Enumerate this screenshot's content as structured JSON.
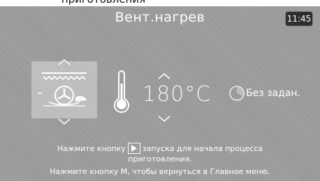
{
  "header": {
    "top_cut_text": "приготовления",
    "title": "Вент.нагрев",
    "clock": "11:45"
  },
  "mode": {
    "icon": "fan-heating-icon"
  },
  "temperature": {
    "value": "180°C",
    "icon": "thermometer-icon"
  },
  "timer": {
    "icon": "timer-icon",
    "label": "Без задан."
  },
  "instructions": {
    "line1_before": "Нажмите кнопку",
    "line1_after": "запуска для начала процесса",
    "line2": "приготовления.",
    "line3": "Нажмите кнопку M, чтобы вернуться в Главное меню.",
    "play_icon": "play-icon"
  },
  "colors": {
    "background": "#9c9c9c",
    "text": "#ffffff",
    "clock_bg": "#2e2e2e"
  }
}
